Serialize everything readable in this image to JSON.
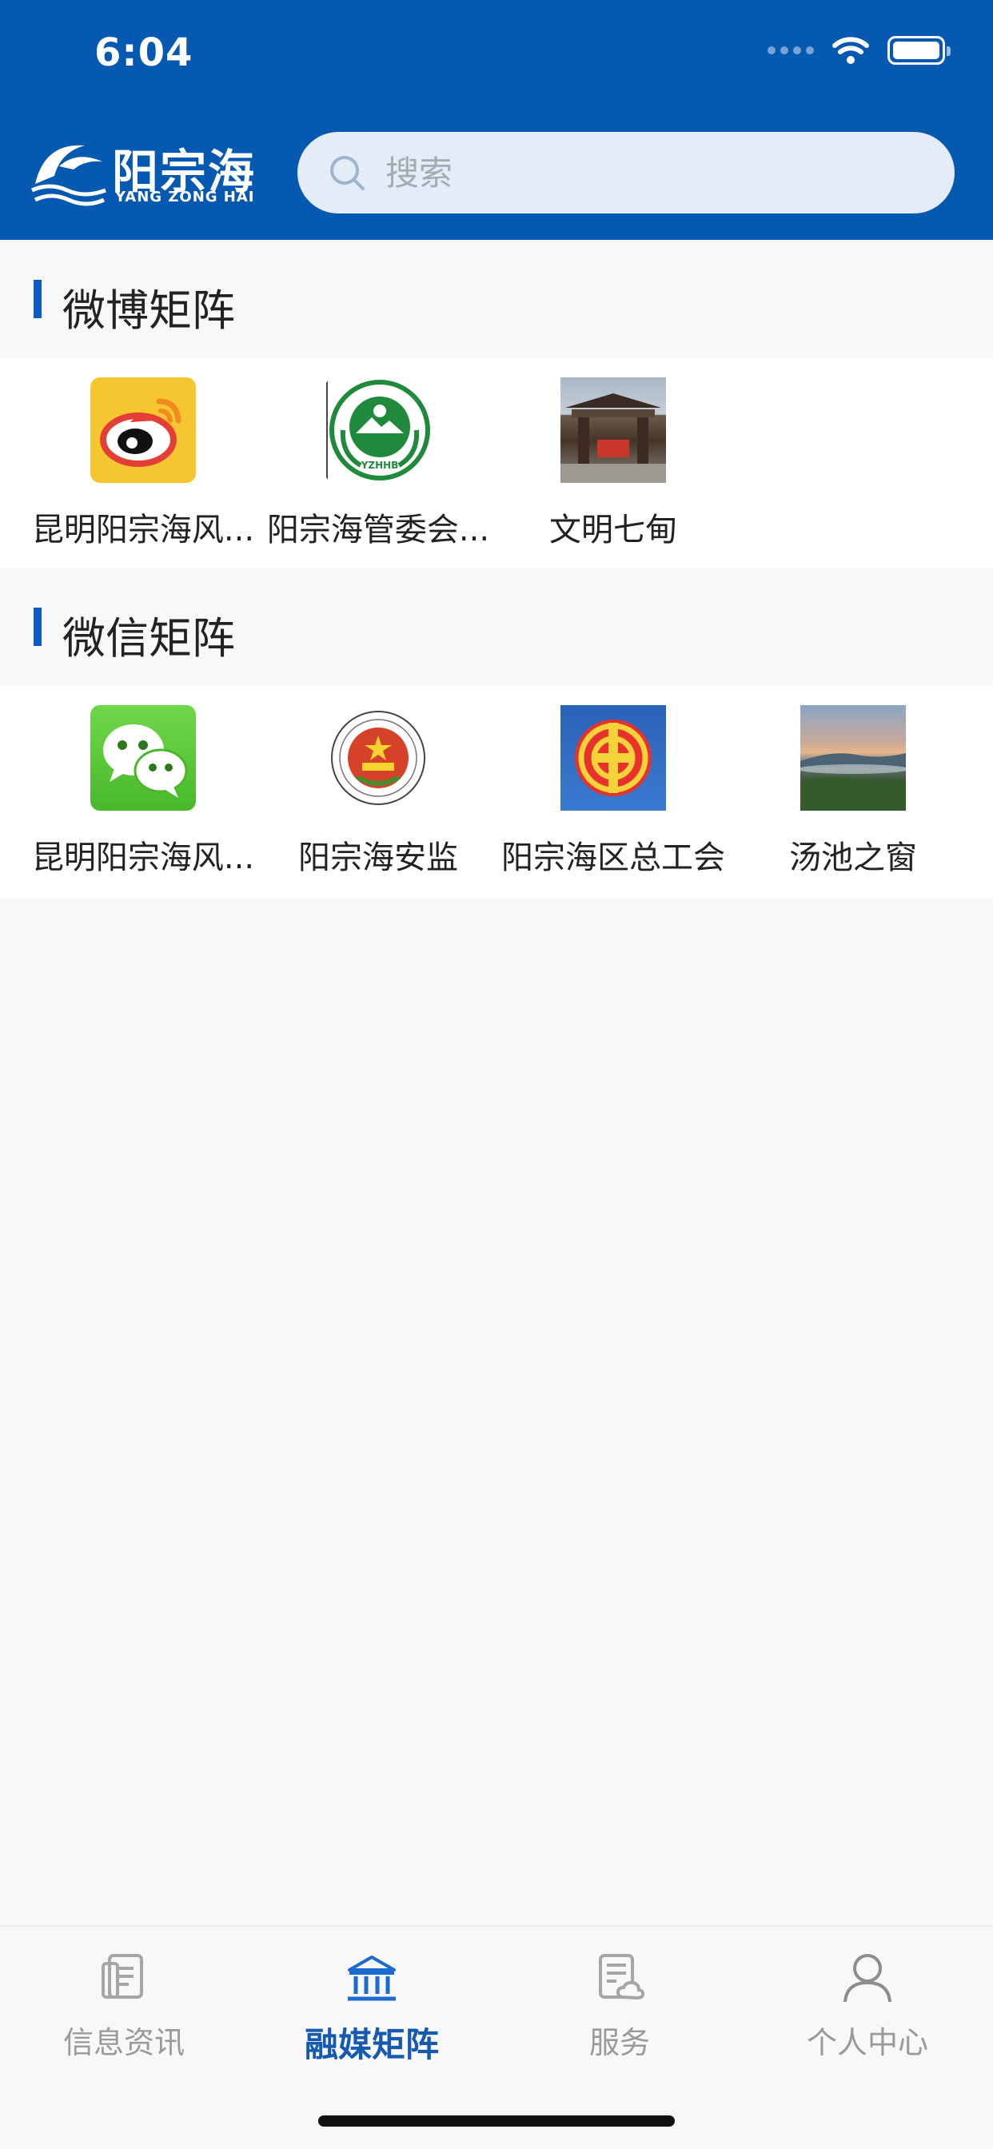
{
  "status": {
    "time": "6:04"
  },
  "header": {
    "logo_cn": "阳宗海",
    "logo_en": "YANG ZONG HAI",
    "search_placeholder": "搜索"
  },
  "sections": [
    {
      "title": "微博矩阵",
      "items": [
        {
          "label": "昆明阳宗海风...",
          "icon": "weibo-icon"
        },
        {
          "label": "阳宗海管委会...",
          "icon": "yzhhb-emblem-icon"
        },
        {
          "label": "文明七甸",
          "icon": "gate-photo"
        }
      ]
    },
    {
      "title": "微信矩阵",
      "items": [
        {
          "label": "昆明阳宗海风...",
          "icon": "wechat-icon"
        },
        {
          "label": "阳宗海安监",
          "icon": "safety-emblem-icon"
        },
        {
          "label": "阳宗海区总工会",
          "icon": "union-emblem-icon"
        },
        {
          "label": "汤池之窗",
          "icon": "lake-photo"
        }
      ]
    }
  ],
  "tabbar": {
    "items": [
      {
        "label": "信息资讯",
        "icon": "news-icon",
        "active": false
      },
      {
        "label": "融媒矩阵",
        "icon": "bank-icon",
        "active": true
      },
      {
        "label": "服务",
        "icon": "service-icon",
        "active": false
      },
      {
        "label": "个人中心",
        "icon": "person-icon",
        "active": false
      }
    ]
  },
  "colors": {
    "header_bg": "#0659b0",
    "accent": "#0a5cc0",
    "tab_active": "#1559b0",
    "tab_inactive": "#9a9a9a"
  },
  "logo_text": "YZHHB"
}
